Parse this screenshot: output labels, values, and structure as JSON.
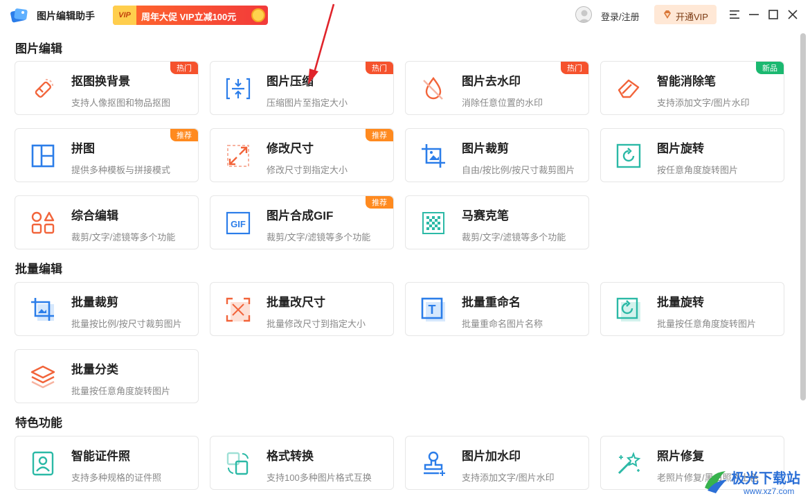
{
  "app": {
    "title": "图片编辑助手",
    "promo_text": "周年大促 VIP立减100元",
    "promo_tag": "VIP",
    "login_label": "登录/注册",
    "vip_button_label": "开通VIP"
  },
  "sections": [
    {
      "title": "图片编辑",
      "cards": [
        {
          "title": "抠图换背景",
          "desc": "支持人像抠图和物品抠图",
          "badge": "热门",
          "badge_kind": "hot",
          "icon": "eraser-icon"
        },
        {
          "title": "图片压缩",
          "desc": "压缩图片至指定大小",
          "badge": "热门",
          "badge_kind": "hot",
          "icon": "compress-icon"
        },
        {
          "title": "图片去水印",
          "desc": "消除任意位置的水印",
          "badge": "热门",
          "badge_kind": "hot",
          "icon": "no-watermark-icon"
        },
        {
          "title": "智能消除笔",
          "desc": "支持添加文字/图片水印",
          "badge": "新品",
          "badge_kind": "new",
          "icon": "smart-eraser-icon"
        },
        {
          "title": "拼图",
          "desc": "提供多种模板与拼接模式",
          "badge": "推荐",
          "badge_kind": "rec",
          "icon": "collage-icon"
        },
        {
          "title": "修改尺寸",
          "desc": "修改尺寸到指定大小",
          "badge": "推荐",
          "badge_kind": "rec",
          "icon": "resize-icon"
        },
        {
          "title": "图片裁剪",
          "desc": "自由/按比例/按尺寸裁剪图片",
          "badge": "",
          "badge_kind": "",
          "icon": "crop-icon"
        },
        {
          "title": "图片旋转",
          "desc": "按任意角度旋转图片",
          "badge": "",
          "badge_kind": "",
          "icon": "rotate-icon"
        },
        {
          "title": "综合编辑",
          "desc": "裁剪/文字/滤镜等多个功能",
          "badge": "",
          "badge_kind": "",
          "icon": "shapes-icon"
        },
        {
          "title": "图片合成GIF",
          "desc": "裁剪/文字/滤镜等多个功能",
          "badge": "推荐",
          "badge_kind": "rec",
          "icon": "gif-icon",
          "icon_text": "GIF"
        },
        {
          "title": "马赛克笔",
          "desc": "裁剪/文字/滤镜等多个功能",
          "badge": "",
          "badge_kind": "",
          "icon": "mosaic-icon"
        }
      ]
    },
    {
      "title": "批量编辑",
      "cards": [
        {
          "title": "批量裁剪",
          "desc": "批量按比例/按尺寸裁剪图片",
          "badge": "",
          "badge_kind": "",
          "icon": "batch-crop-icon"
        },
        {
          "title": "批量改尺寸",
          "desc": "批量修改尺寸到指定大小",
          "badge": "",
          "badge_kind": "",
          "icon": "batch-resize-icon"
        },
        {
          "title": "批量重命名",
          "desc": "批量重命名图片名称",
          "badge": "",
          "badge_kind": "",
          "icon": "rename-icon",
          "icon_text": "T"
        },
        {
          "title": "批量旋转",
          "desc": "批量按任意角度旋转图片",
          "badge": "",
          "badge_kind": "",
          "icon": "batch-rotate-icon"
        },
        {
          "title": "批量分类",
          "desc": "批量按任意角度旋转图片",
          "badge": "",
          "badge_kind": "",
          "icon": "layers-icon"
        }
      ]
    },
    {
      "title": "特色功能",
      "cards": [
        {
          "title": "智能证件照",
          "desc": "支持多种规格的证件照",
          "badge": "",
          "badge_kind": "",
          "icon": "id-photo-icon"
        },
        {
          "title": "格式转换",
          "desc": "支持100多种图片格式互换",
          "badge": "",
          "badge_kind": "",
          "icon": "convert-icon"
        },
        {
          "title": "图片加水印",
          "desc": "支持添加文字/图片水印",
          "badge": "",
          "badge_kind": "",
          "icon": "stamp-icon"
        },
        {
          "title": "照片修复",
          "desc": "老照片修复/黑白照片上色",
          "badge": "",
          "badge_kind": "",
          "icon": "magic-wand-icon"
        }
      ]
    }
  ],
  "watermark": {
    "text": "极光下载站",
    "url": "www.xz7.com"
  },
  "colors": {
    "accent_blue": "#2b7de9",
    "accent_orange": "#f2643a",
    "accent_teal": "#2bb9a6"
  }
}
